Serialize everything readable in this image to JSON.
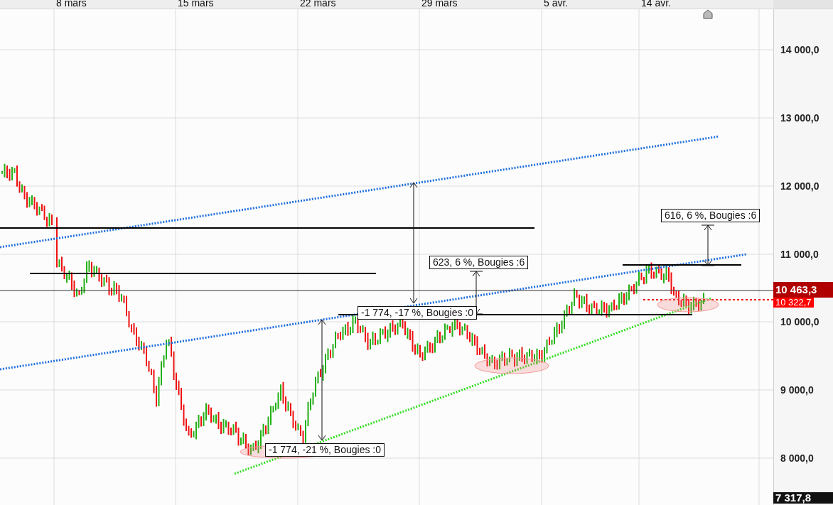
{
  "date_axis": {
    "labels": [
      "8 mars",
      "15 mars",
      "22 mars",
      "29 mars",
      "5 avr.",
      "14 avr."
    ]
  },
  "price_axis": {
    "labels": [
      "14 000,0",
      "13 000,0",
      "12 000,0",
      "11 000,0",
      "10 000,0",
      "9 000,0",
      "8 000,0"
    ],
    "last_price": "10 463,3",
    "bid_price": "10 322,7",
    "low_price": "7 317,8"
  },
  "annotations": [
    {
      "text": "616, 6 %, Bougies :6"
    },
    {
      "text": "623, 6 %, Bougies :6"
    },
    {
      "text": "-1 774, -17 %, Bougies :0"
    },
    {
      "text": "-1 774, -21 %, Bougies :0"
    }
  ]
}
